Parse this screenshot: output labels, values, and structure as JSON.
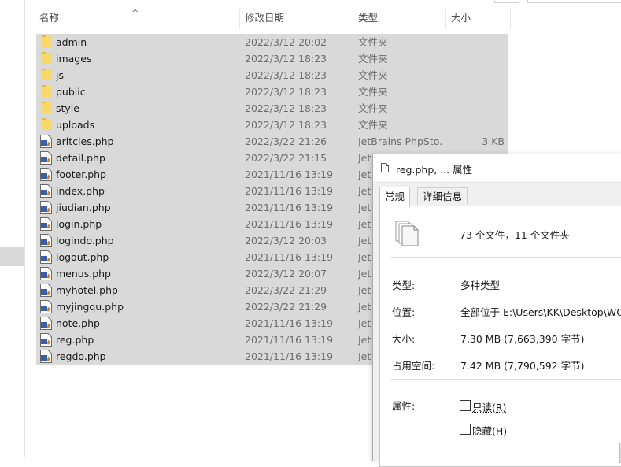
{
  "columns": {
    "name": "名称",
    "modified": "修改日期",
    "type": "类型",
    "size": "大小"
  },
  "files": [
    {
      "name": "admin",
      "icon": "folder-icon",
      "date": "2022/3/12 20:02",
      "type": "文件夹",
      "size": ""
    },
    {
      "name": "images",
      "icon": "folder-icon",
      "date": "2022/3/12 18:23",
      "type": "文件夹",
      "size": ""
    },
    {
      "name": "js",
      "icon": "folder-icon",
      "date": "2022/3/12 18:23",
      "type": "文件夹",
      "size": ""
    },
    {
      "name": "public",
      "icon": "folder-icon",
      "date": "2022/3/12 18:23",
      "type": "文件夹",
      "size": ""
    },
    {
      "name": "style",
      "icon": "folder-icon",
      "date": "2022/3/12 18:23",
      "type": "文件夹",
      "size": ""
    },
    {
      "name": "uploads",
      "icon": "folder-icon",
      "date": "2022/3/12 18:23",
      "type": "文件夹",
      "size": ""
    },
    {
      "name": "aritcles.php",
      "icon": "php-file-icon",
      "date": "2022/3/22 21:26",
      "type": "JetBrains PhpSto...",
      "size": "3 KB"
    },
    {
      "name": "detail.php",
      "icon": "php-file-icon",
      "date": "2022/3/22 21:15",
      "type": "Jet",
      "size": ""
    },
    {
      "name": "footer.php",
      "icon": "php-file-icon",
      "date": "2021/11/16 13:19",
      "type": "Jet",
      "size": ""
    },
    {
      "name": "index.php",
      "icon": "php-file-icon",
      "date": "2021/11/16 13:19",
      "type": "Jet",
      "size": ""
    },
    {
      "name": "jiudian.php",
      "icon": "php-file-icon",
      "date": "2021/11/16 13:19",
      "type": "Jet",
      "size": ""
    },
    {
      "name": "login.php",
      "icon": "php-file-icon",
      "date": "2021/11/16 13:19",
      "type": "Jet",
      "size": ""
    },
    {
      "name": "logindo.php",
      "icon": "php-file-icon",
      "date": "2022/3/12 20:03",
      "type": "Jet",
      "size": ""
    },
    {
      "name": "logout.php",
      "icon": "php-file-icon",
      "date": "2021/11/16 13:19",
      "type": "Jet",
      "size": ""
    },
    {
      "name": "menus.php",
      "icon": "php-file-icon",
      "date": "2022/3/12 20:07",
      "type": "Jet",
      "size": ""
    },
    {
      "name": "myhotel.php",
      "icon": "php-file-icon",
      "date": "2022/3/22 21:29",
      "type": "Jet",
      "size": ""
    },
    {
      "name": "myjingqu.php",
      "icon": "php-file-icon",
      "date": "2022/3/22 21:29",
      "type": "Jet",
      "size": ""
    },
    {
      "name": "note.php",
      "icon": "php-file-icon",
      "date": "2021/11/16 13:19",
      "type": "Jet",
      "size": ""
    },
    {
      "name": "reg.php",
      "icon": "php-file-icon",
      "date": "2021/11/16 13:19",
      "type": "Jet",
      "size": ""
    },
    {
      "name": "regdo.php",
      "icon": "php-file-icon",
      "date": "2021/11/16 13:19",
      "type": "Jet",
      "size": ""
    }
  ],
  "dialog": {
    "title": "reg.php, ... 属性",
    "tabs": [
      "常规",
      "详细信息"
    ],
    "summary": "73 个文件，11 个文件夹",
    "type_label": "类型:",
    "type_value": "多种类型",
    "location_label": "位置:",
    "location_value": "全部位于 E:\\Users\\KK\\Desktop\\WOF",
    "size_label": "大小:",
    "size_value": "7.30 MB (7,663,390 字节)",
    "disk_label": "占用空间:",
    "disk_value": "7.42 MB (7,790,592 字节)",
    "attributes_label": "属性:",
    "readonly": {
      "label": "只读(R)",
      "checked": false
    },
    "hidden": {
      "label": "隐藏(H)",
      "checked": false
    }
  },
  "colors": {
    "selection": "#d9d9d9",
    "folder": "#f8d76b",
    "php_icon": "#3b5ea8",
    "dialog_bg": "#f0f0f0"
  }
}
